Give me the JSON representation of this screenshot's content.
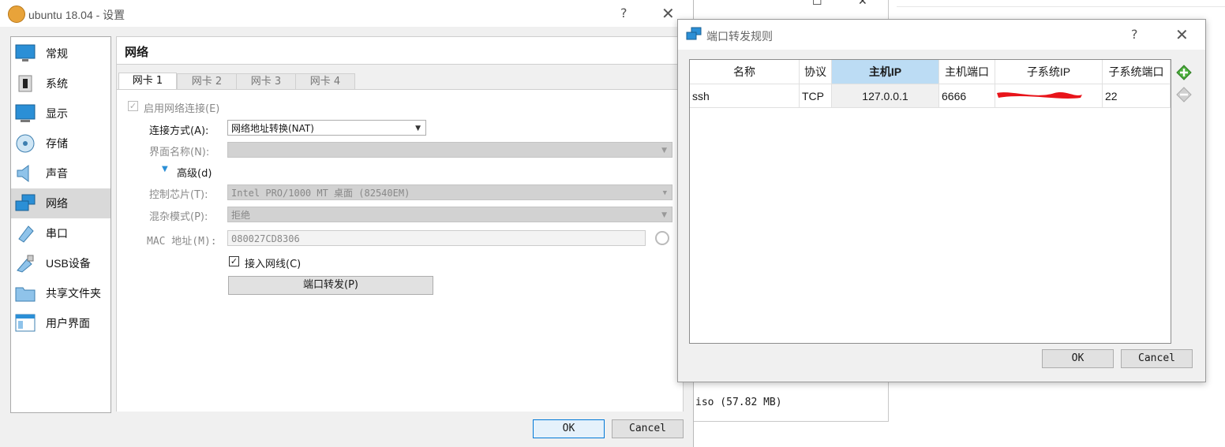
{
  "settings_window": {
    "title": "ubuntu 18.04 - 设置",
    "help_glyph": "?",
    "close_glyph": "✕",
    "nav": [
      {
        "label": "常规",
        "icon": "monitor-icon"
      },
      {
        "label": "系统",
        "icon": "chip-icon"
      },
      {
        "label": "显示",
        "icon": "display-icon"
      },
      {
        "label": "存储",
        "icon": "disk-icon"
      },
      {
        "label": "声音",
        "icon": "speaker-icon"
      },
      {
        "label": "网络",
        "icon": "network-icon",
        "selected": true
      },
      {
        "label": "串口",
        "icon": "serial-port-icon"
      },
      {
        "label": "USB设备",
        "icon": "usb-icon"
      },
      {
        "label": "共享文件夹",
        "icon": "folder-icon"
      },
      {
        "label": "用户界面",
        "icon": "ui-window-icon"
      }
    ],
    "page_title": "网络",
    "tabs": [
      "网卡 1",
      "网卡 2",
      "网卡 3",
      "网卡 4"
    ],
    "enable_network_label": "启用网络连接(E)",
    "attach_label": "连接方式(A):",
    "attach_value": "网络地址转换(NAT)",
    "interface_label": "界面名称(N):",
    "interface_value": "",
    "advanced_label": "高级(d)",
    "adapter_label": "控制芯片(T):",
    "adapter_value": "Intel PRO/1000 MT 桌面 (82540EM)",
    "promisc_label": "混杂模式(P):",
    "promisc_value": "拒绝",
    "mac_label": "MAC 地址(M):",
    "mac_value": "080027CD8306",
    "cable_label": "接入网线(C)",
    "cable_checked": true,
    "port_forward_label": "端口转发(P)",
    "ok_label": "OK",
    "cancel_label": "Cancel"
  },
  "background_window": {
    "iso_text": "iso (57.82 MB)"
  },
  "port_forwarding_dialog": {
    "title": "端口转发规则",
    "help_glyph": "?",
    "close_glyph": "✕",
    "columns": [
      "名称",
      "协议",
      "主机IP",
      "主机端口",
      "子系统IP",
      "子系统端口"
    ],
    "sorted_column": "主机IP",
    "rows": [
      {
        "name": "ssh",
        "protocol": "TCP",
        "host_ip": "127.0.0.1",
        "host_port": "6666",
        "guest_ip": "",
        "guest_port": "22"
      }
    ],
    "ok_label": "OK",
    "cancel_label": "Cancel",
    "accent_color": "#bcdcf4",
    "redaction_color": "#e8141a"
  }
}
